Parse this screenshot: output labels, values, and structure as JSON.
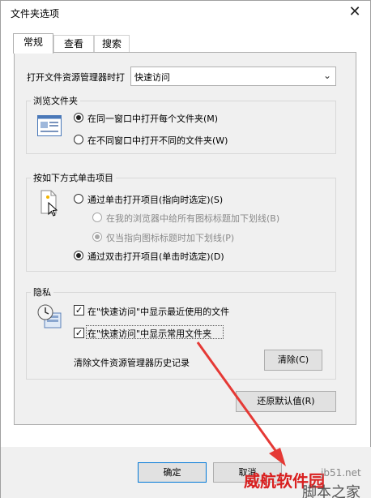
{
  "window": {
    "title": "文件夹选项"
  },
  "tabs": [
    {
      "label": "常规",
      "active": true
    },
    {
      "label": "查看",
      "active": false
    },
    {
      "label": "搜索",
      "active": false
    }
  ],
  "open_explorer": {
    "label": "打开文件资源管理器时打",
    "value": "快速访问"
  },
  "browse": {
    "title": "浏览文件夹",
    "option1": "在同一窗口中打开每个文件夹(M)",
    "option2": "在不同窗口中打开不同的文件夹(W)"
  },
  "click": {
    "title": "按如下方式单击项目",
    "single": "通过单击打开项目(指向时选定)(S)",
    "underline_all": "在我的浏览器中给所有图标标题加下划线(B)",
    "underline_hover": "仅当指向图标标题时加下划线(P)",
    "double": "通过双击打开项目(单击时选定)(D)"
  },
  "privacy": {
    "title": "隐私",
    "recent_files": "在\"快速访问\"中显示最近使用的文件",
    "frequent_folders": "在\"快速访问\"中显示常用文件夹",
    "clear_label": "清除文件资源管理器历史记录",
    "clear_button": "清除(C)"
  },
  "restore_button": "还原默认值(R)",
  "footer": {
    "ok": "确定",
    "cancel": "取消"
  },
  "watermark": {
    "brand": "威航软件园",
    "site": "jb51.net",
    "tag": "脚本之家"
  },
  "colors": {
    "accent": "#0078d7",
    "annotation_arrow": "#e53935"
  }
}
